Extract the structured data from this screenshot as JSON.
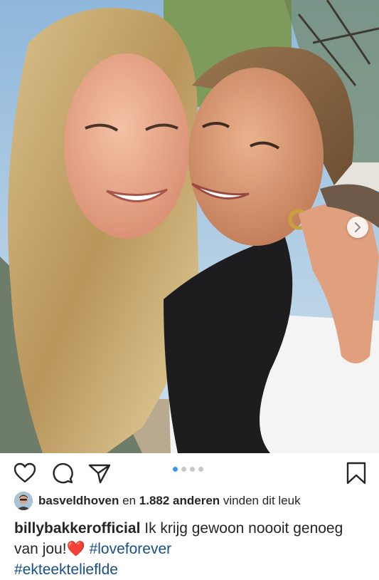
{
  "post": {
    "photo_alt": "",
    "carousel": {
      "count": 4,
      "active_index": 0
    },
    "next_icon": "chevron-right-icon"
  },
  "actions": {
    "like_icon": "heart-icon",
    "comment_icon": "comment-icon",
    "share_icon": "send-icon",
    "save_icon": "bookmark-icon"
  },
  "likes": {
    "user": "basveldhoven",
    "connector": "en",
    "count": "1.882 anderen",
    "suffix": "vinden dit leuk"
  },
  "caption": {
    "username": "billybakkerofficial",
    "text": "Ik krijg gewoon noooit genoeg van jou!",
    "emoji": "❤️",
    "hashtag1": "#loveforever",
    "hashtag2": "#ekteektelieflde"
  },
  "colors": {
    "accent": "#3897f0",
    "hashtag": "#1b4f87"
  }
}
